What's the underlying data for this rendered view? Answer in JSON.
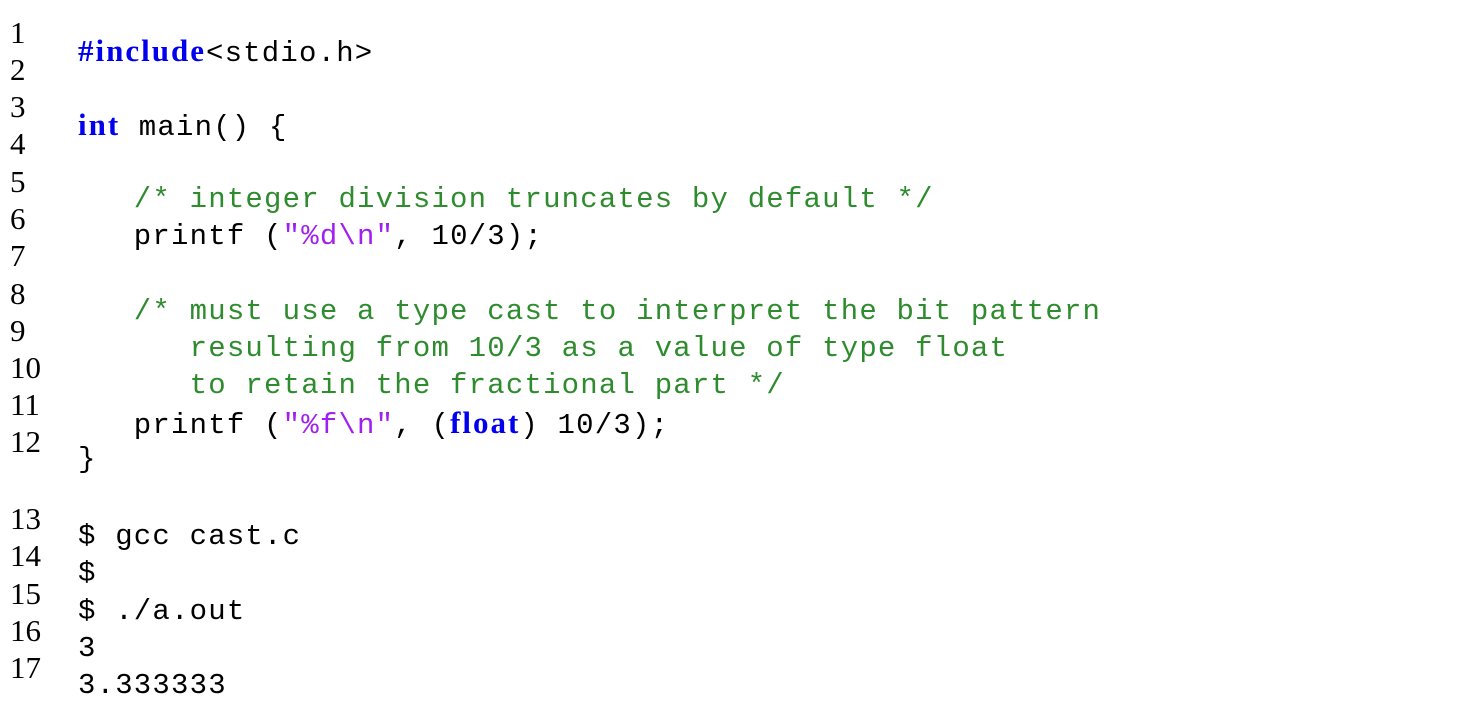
{
  "listing": {
    "lines": [
      {
        "n": "1",
        "top": 0
      },
      {
        "n": "2"
      },
      {
        "n": "3"
      },
      {
        "n": "4"
      },
      {
        "n": "5"
      },
      {
        "n": "6"
      },
      {
        "n": "7"
      },
      {
        "n": "8"
      },
      {
        "n": "9"
      },
      {
        "n": "10"
      },
      {
        "n": "11"
      },
      {
        "n": "12"
      },
      {
        "n": "13"
      },
      {
        "n": "14"
      },
      {
        "n": "15"
      },
      {
        "n": "16"
      },
      {
        "n": "17"
      }
    ],
    "tokens": {
      "l1_kw": "#include",
      "l1_rest": "<stdio.h>",
      "l3_kw": "int",
      "l3_rest": " main() {",
      "l5_comment": "   /* integer division truncates by default */",
      "l6_a": "   printf (",
      "l6_str": "\"%d\\n\"",
      "l6_b": ", 10/3);",
      "l8_comment": "   /* must use a type cast to interpret the bit pattern",
      "l9_comment": "      resulting from 10/3 as a value of type float",
      "l10_comment": "      to retain the fractional part */",
      "l11_a": "   printf (",
      "l11_str": "\"%f\\n\"",
      "l11_b": ", (",
      "l11_kw": "float",
      "l11_c": ") 10/3);",
      "l12": "}",
      "l13": "$ gcc cast.c",
      "l14": "$",
      "l15": "$ ./a.out",
      "l16": "3",
      "l17": "3.333333"
    }
  },
  "colors": {
    "keyword": "#0000ee",
    "comment": "#2e8b2e",
    "string": "#a020f0"
  }
}
